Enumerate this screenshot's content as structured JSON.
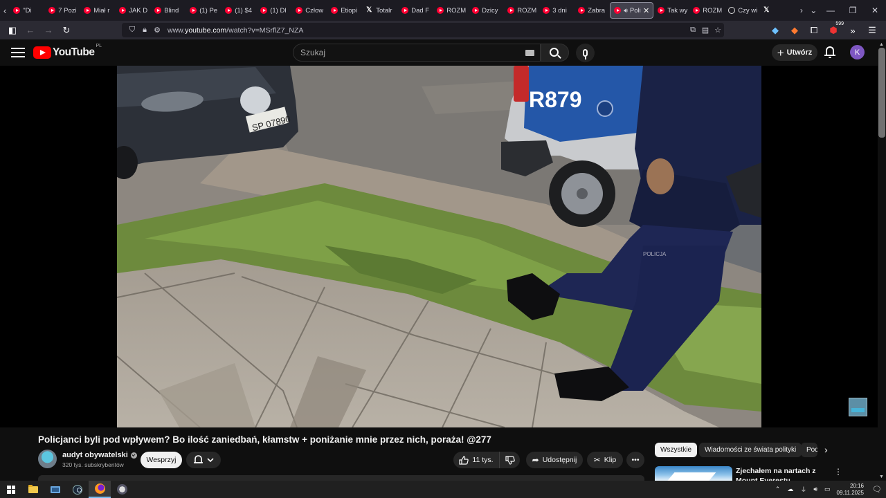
{
  "browser": {
    "tabs": [
      {
        "label": "\"Di",
        "icon": "youtube-icon"
      },
      {
        "label": "7 Pozi",
        "icon": "youtube-icon"
      },
      {
        "label": "Miał r",
        "icon": "youtube-icon"
      },
      {
        "label": "JAK D",
        "icon": "youtube-icon"
      },
      {
        "label": "Blind",
        "icon": "youtube-icon"
      },
      {
        "label": "(1) Pe",
        "icon": "youtube-icon"
      },
      {
        "label": "(1) $4",
        "icon": "youtube-icon"
      },
      {
        "label": "(1) Dl",
        "icon": "youtube-icon"
      },
      {
        "label": "Człow",
        "icon": "youtube-icon"
      },
      {
        "label": "Etiopi",
        "icon": "youtube-icon"
      },
      {
        "label": "Totalr",
        "icon": "x-icon"
      },
      {
        "label": "Dad F",
        "icon": "youtube-icon"
      },
      {
        "label": "ROZM",
        "icon": "youtube-icon"
      },
      {
        "label": "Dzicy",
        "icon": "youtube-icon"
      },
      {
        "label": "ROZM",
        "icon": "youtube-icon"
      },
      {
        "label": "3 dni",
        "icon": "youtube-icon"
      },
      {
        "label": "Zabra",
        "icon": "youtube-icon"
      },
      {
        "label": "Poli",
        "icon": "youtube-icon",
        "active": true
      },
      {
        "label": "Tak wy",
        "icon": "youtube-icon"
      },
      {
        "label": "ROZM",
        "icon": "youtube-icon"
      },
      {
        "label": "Czy wi",
        "icon": "globe-icon"
      },
      {
        "label": "",
        "icon": "x-icon"
      }
    ],
    "url_prefix": "www.",
    "url_domain": "youtube.com",
    "url_path": "/watch?v=MSrflZ7_NZA",
    "extension_badge": "599"
  },
  "youtube": {
    "logo_text": "YouTube",
    "region": "PL",
    "search_placeholder": "Szukaj",
    "create_label": "Utwórz",
    "avatar_letter": "K"
  },
  "video": {
    "title": "Policjanci byli pod wpływem? Bo ilość zaniedbań, kłamstw + poniżanie mnie przez nich, poraża! @277",
    "channel_name": "audyt obywatelski",
    "subscribers": "320 tys. subskrybentów",
    "support_label": "Wesprzyj",
    "likes": "11 tys.",
    "share_label": "Udostępnij",
    "clip_label": "Klip",
    "scene": {
      "plate": "SP 07890",
      "police_car_number": "R879",
      "trouser_text": "POLICJA"
    }
  },
  "chips": [
    "Wszystkie",
    "Wiadomości ze świata polityki",
    "Podobne"
  ],
  "recommendation": {
    "title": "Zjechałem na nartach z Mount Everestu"
  },
  "taskbar": {
    "time": "20:16",
    "date": "09.11.2025"
  },
  "colors": {
    "youtube_red": "#ff0000",
    "background": "#0f0f0f",
    "chip_selected": "#f1f1f1",
    "firefox_chrome": "#2b2a33"
  }
}
